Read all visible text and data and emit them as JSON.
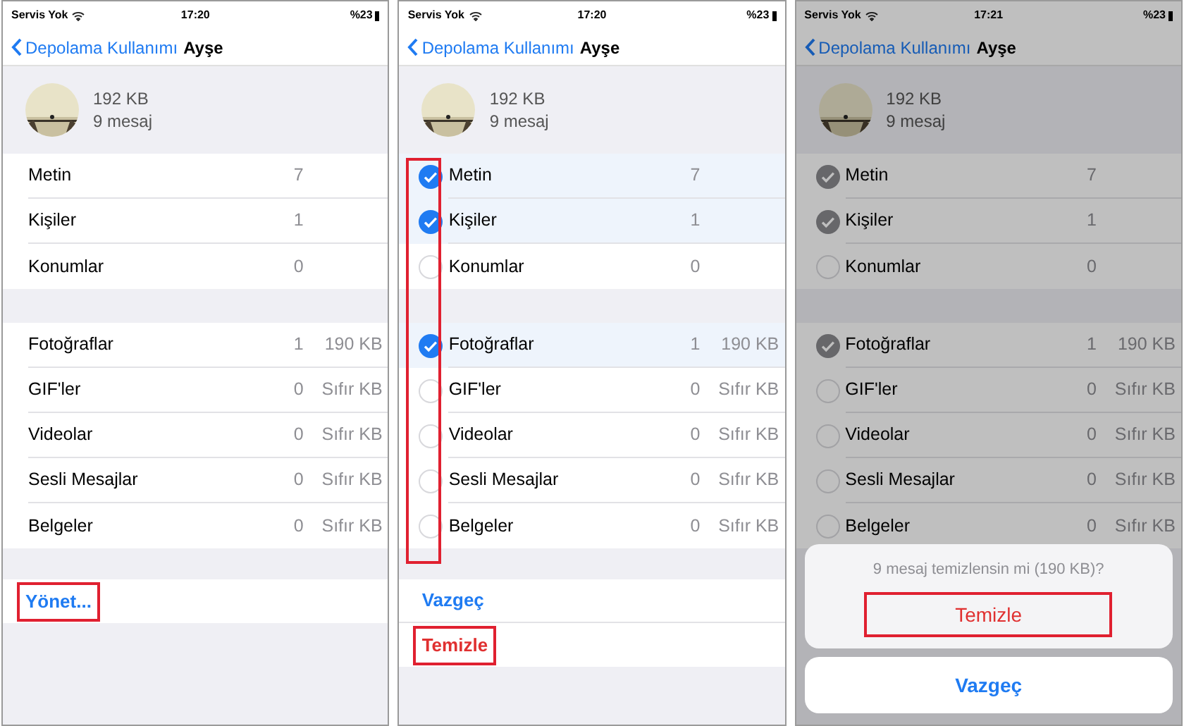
{
  "screens": [
    {
      "status_bar": {
        "carrier": "Servis Yok",
        "time": "17:20",
        "battery": "%23"
      },
      "nav": {
        "back": "Depolama Kullanımı",
        "title": "Ayşe"
      },
      "summary": {
        "size": "192 KB",
        "count": "9 mesaj"
      },
      "groups": [
        [
          {
            "label": "Metin",
            "count": "7"
          },
          {
            "label": "Kişiler",
            "count": "1"
          },
          {
            "label": "Konumlar",
            "count": "0"
          }
        ],
        [
          {
            "label": "Fotoğraflar",
            "count": "1",
            "size": "190 KB"
          },
          {
            "label": "GIF'ler",
            "count": "0",
            "size": "Sıfır KB"
          },
          {
            "label": "Videolar",
            "count": "0",
            "size": "Sıfır KB"
          },
          {
            "label": "Sesli Mesajlar",
            "count": "0",
            "size": "Sıfır KB"
          },
          {
            "label": "Belgeler",
            "count": "0",
            "size": "Sıfır KB"
          }
        ]
      ],
      "actions": [
        {
          "label": "Yönet...",
          "kind": "link",
          "highlighted": true
        }
      ]
    },
    {
      "status_bar": {
        "carrier": "Servis Yok",
        "time": "17:20",
        "battery": "%23"
      },
      "nav": {
        "back": "Depolama Kullanımı",
        "title": "Ayşe"
      },
      "summary": {
        "size": "192 KB",
        "count": "9 mesaj"
      },
      "checkbox_column_highlighted": true,
      "groups": [
        [
          {
            "label": "Metin",
            "count": "7",
            "checked": true
          },
          {
            "label": "Kişiler",
            "count": "1",
            "checked": true
          },
          {
            "label": "Konumlar",
            "count": "0",
            "checked": false
          }
        ],
        [
          {
            "label": "Fotoğraflar",
            "count": "1",
            "size": "190 KB",
            "checked": true
          },
          {
            "label": "GIF'ler",
            "count": "0",
            "size": "Sıfır KB",
            "checked": false
          },
          {
            "label": "Videolar",
            "count": "0",
            "size": "Sıfır KB",
            "checked": false
          },
          {
            "label": "Sesli Mesajlar",
            "count": "0",
            "size": "Sıfır KB",
            "checked": false
          },
          {
            "label": "Belgeler",
            "count": "0",
            "size": "Sıfır KB",
            "checked": false
          }
        ]
      ],
      "actions": [
        {
          "label": "Vazgeç",
          "kind": "link",
          "highlighted": false
        },
        {
          "label": "Temizle",
          "kind": "destructive",
          "highlighted": true
        }
      ]
    },
    {
      "status_bar": {
        "carrier": "Servis Yok",
        "time": "17:21",
        "battery": "%23"
      },
      "nav": {
        "back": "Depolama Kullanımı",
        "title": "Ayşe"
      },
      "summary": {
        "size": "192 KB",
        "count": "9 mesaj"
      },
      "dimmed": true,
      "groups": [
        [
          {
            "label": "Metin",
            "count": "7",
            "checked": true
          },
          {
            "label": "Kişiler",
            "count": "1",
            "checked": true
          },
          {
            "label": "Konumlar",
            "count": "0",
            "checked": false
          }
        ],
        [
          {
            "label": "Fotoğraflar",
            "count": "1",
            "size": "190 KB",
            "checked": true
          },
          {
            "label": "GIF'ler",
            "count": "0",
            "size": "Sıfır KB",
            "checked": false
          },
          {
            "label": "Videolar",
            "count": "0",
            "size": "Sıfır KB",
            "checked": false
          },
          {
            "label": "Sesli Mesajlar",
            "count": "0",
            "size": "Sıfır KB",
            "checked": false
          },
          {
            "label": "Belgeler",
            "count": "0",
            "size": "Sıfır KB",
            "checked": false
          }
        ]
      ],
      "sheet": {
        "message": "9 mesaj temizlensin mi (190 KB)?",
        "confirm": {
          "label": "Temizle",
          "highlighted": true
        },
        "cancel": {
          "label": "Vazgeç"
        }
      }
    }
  ]
}
